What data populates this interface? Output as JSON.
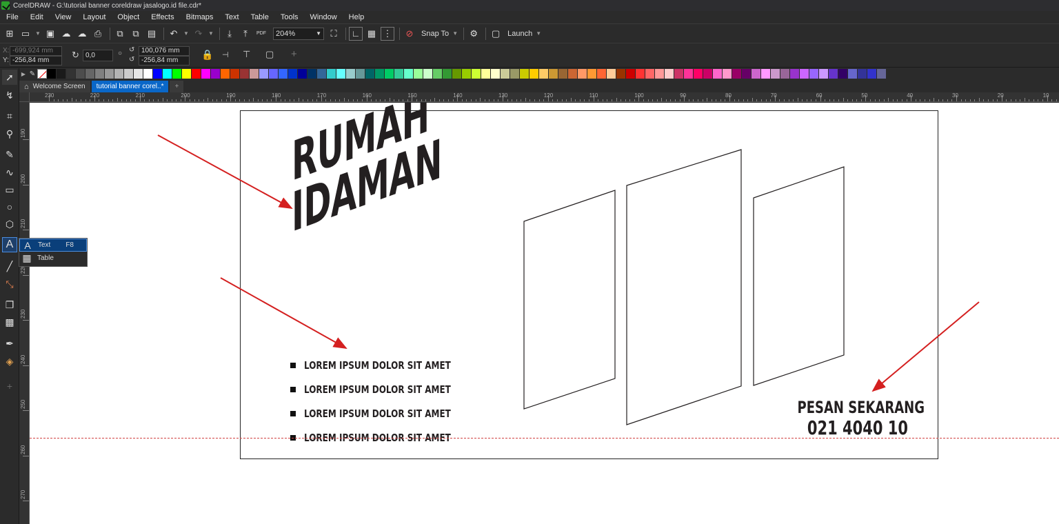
{
  "window": {
    "title": "CorelDRAW - G:\\tutorial banner coreldraw jasalogo.id file.cdr*"
  },
  "menu": [
    "File",
    "Edit",
    "View",
    "Layout",
    "Object",
    "Effects",
    "Bitmaps",
    "Text",
    "Table",
    "Tools",
    "Window",
    "Help"
  ],
  "toolbar": {
    "zoom": "204%",
    "snap_label": "Snap To",
    "launch_label": "Launch",
    "pdf_label": "PDF"
  },
  "props": {
    "x_label": "X:",
    "x_value": "-699,924 mm",
    "y_label": "Y:",
    "y_value": "-256,84 mm",
    "angle": "0,0",
    "w_value": "100,076 mm",
    "h_value": "-256,84 mm"
  },
  "tabs": {
    "welcome": "Welcome Screen",
    "doc": "tutorial banner corel..*",
    "add": "+"
  },
  "flyout": {
    "text_label": "Text",
    "text_shortcut": "F8",
    "table_label": "Table"
  },
  "ruler": {
    "h": [
      "230",
      "220",
      "210",
      "200",
      "190",
      "180",
      "170",
      "160",
      "150",
      "140",
      "130",
      "120",
      "110",
      "100",
      "90",
      "80",
      "70",
      "60",
      "50",
      "40",
      "30",
      "20",
      "10"
    ],
    "v": [
      "190",
      "200",
      "210",
      "220",
      "230",
      "240",
      "250",
      "260",
      "270"
    ]
  },
  "palette": [
    "#000000",
    "#1a1a1a",
    "#333333",
    "#4d4d4d",
    "#666666",
    "#808080",
    "#999999",
    "#b3b3b3",
    "#cccccc",
    "#e6e6e6",
    "#ffffff",
    "#0000ff",
    "#00ffff",
    "#00ff00",
    "#ffff00",
    "#ff0000",
    "#ff00ff",
    "#9900cc",
    "#ff6600",
    "#cc3300",
    "#993333",
    "#cc9999",
    "#9999ff",
    "#6666ff",
    "#3366ff",
    "#0033cc",
    "#000099",
    "#003366",
    "#336699",
    "#33cccc",
    "#66ffff",
    "#99cccc",
    "#669999",
    "#006666",
    "#009966",
    "#00cc66",
    "#33cc99",
    "#66ffcc",
    "#99ff99",
    "#ccffcc",
    "#66cc66",
    "#339933",
    "#669900",
    "#99cc00",
    "#ccff33",
    "#ffff99",
    "#ffffcc",
    "#cccc99",
    "#999966",
    "#cccc00",
    "#ffcc00",
    "#ffcc66",
    "#cc9933",
    "#996633",
    "#cc6633",
    "#ff9966",
    "#ff9933",
    "#ff6633",
    "#ffcc99",
    "#993300",
    "#cc0000",
    "#ff3333",
    "#ff6666",
    "#ff9999",
    "#ffcccc",
    "#cc3366",
    "#ff3399",
    "#ff0066",
    "#cc0066",
    "#ff66cc",
    "#ff99cc",
    "#990066",
    "#660066",
    "#cc66cc",
    "#ff99ff",
    "#cc99cc",
    "#996699",
    "#9933cc",
    "#cc66ff",
    "#9966ff",
    "#cc99ff",
    "#6633cc",
    "#330066",
    "#6666cc",
    "#333399",
    "#3333cc",
    "#666699"
  ],
  "design": {
    "headline_1": "RUMAH",
    "headline_2": "IDAMAN",
    "bullets": [
      "LOREM IPSUM DOLOR SIT AMET",
      "LOREM IPSUM DOLOR SIT AMET",
      "LOREM IPSUM DOLOR SIT AMET",
      "LOREM IPSUM DOLOR SIT AMET"
    ],
    "cta_1": "PESAN SEKARANG",
    "cta_2": "021 4040 10"
  },
  "colors": {
    "accent": "#0a67c8",
    "arrow": "#d42020",
    "ink": "#231f20"
  }
}
